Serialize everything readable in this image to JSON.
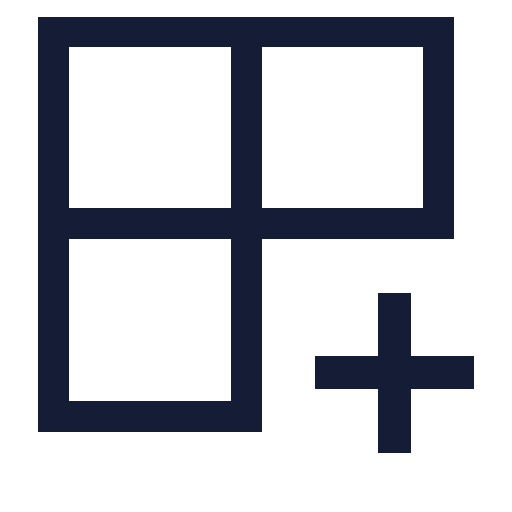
{
  "icon": {
    "name": "add-grid-icon",
    "color": "#151d36",
    "background": "#ffffff"
  }
}
